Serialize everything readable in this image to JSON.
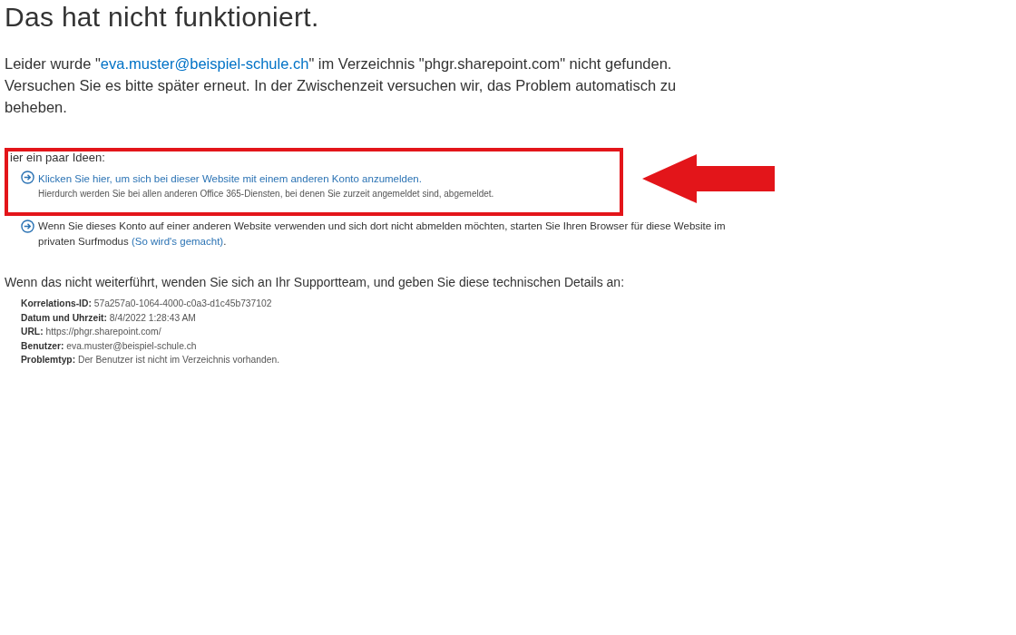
{
  "title": "Das hat nicht funktioniert.",
  "intro": {
    "before": "Leider wurde \"",
    "email": "eva.muster@beispiel-schule.ch",
    "after": "\" im Verzeichnis \"phgr.sharepoint.com\" nicht gefunden. Versuchen Sie es bitte später erneut. In der Zwischenzeit versuchen wir, das Problem automatisch zu beheben."
  },
  "ideas_heading": "ier ein paar Ideen:",
  "ideas": [
    {
      "kind": "link",
      "link": "Klicken Sie hier, um sich bei dieser Website mit einem anderen Konto anzumelden.",
      "note": "Hierdurch werden Sie bei allen anderen Office 365-Diensten, bei denen Sie zurzeit angemeldet sind, abgemeldet.",
      "highlighted": true
    },
    {
      "kind": "text",
      "text": "Wenn Sie dieses Konto auf einer anderen Website verwenden und sich dort nicht abmelden möchten, starten Sie Ihren Browser für diese Website im privaten Surfmodus ",
      "link": "(So wird's gemacht)",
      "after": ".",
      "highlighted": false
    }
  ],
  "support_text": "Wenn das nicht weiterführt, wenden Sie sich an Ihr Supportteam, und geben Sie diese technischen Details an:",
  "details": [
    {
      "label": "Korrelations-ID:",
      "value": "57a257a0-1064-4000-c0a3-d1c45b737102"
    },
    {
      "label": "Datum und Uhrzeit:",
      "value": "8/4/2022 1:28:43 AM"
    },
    {
      "label": "URL:",
      "value": "https://phgr.sharepoint.com/"
    },
    {
      "label": "Benutzer:",
      "value": "eva.muster@beispiel-schule.ch"
    },
    {
      "label": "Problemtyp:",
      "value": "Der Benutzer ist nicht im Verzeichnis vorhanden."
    }
  ]
}
